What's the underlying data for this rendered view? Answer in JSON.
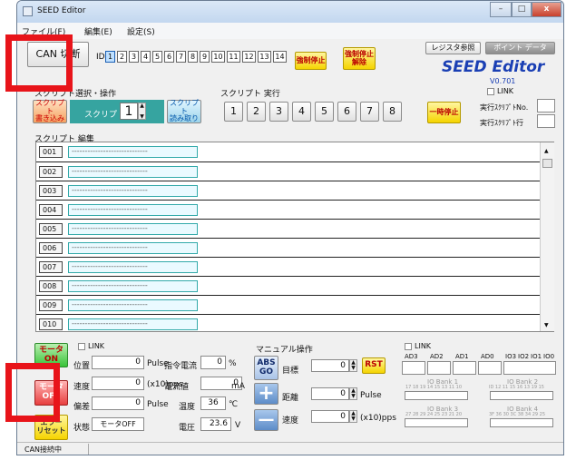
{
  "window": {
    "title": "SEED Editor",
    "minimize": "–",
    "maximize": "□",
    "close": "x"
  },
  "menu": {
    "file": "ファイル(F)",
    "edit": "編集(E)",
    "settings": "設定(S)"
  },
  "top": {
    "can_button": "CAN 切断",
    "id_label": "ID",
    "ids": [
      "1",
      "2",
      "3",
      "4",
      "5",
      "6",
      "7",
      "8",
      "9",
      "10",
      "11",
      "12",
      "13",
      "14"
    ],
    "force_stop": "強制停止",
    "force_release": "強制停止\n解除",
    "register_ref": "レジスタ参照",
    "point_data": "ポイント データ",
    "brand": "SEED Editor",
    "version": "V0.701",
    "link": "LINK",
    "exec_script_no": "実行ｽｸﾘﾌﾟﾄNo.",
    "exec_script_line": "実行ｽｸﾘﾌﾟﾄ行"
  },
  "script_select": {
    "label": "スクリプト選択・操作",
    "write": "スクリプト\n書き込み",
    "script_label": "スクリプト",
    "script_value": "1",
    "read": "スクリプト\n読み取り"
  },
  "script_exec": {
    "label": "スクリプト 実行",
    "buttons": [
      "1",
      "2",
      "3",
      "4",
      "5",
      "6",
      "7",
      "8"
    ],
    "pause": "一時停止"
  },
  "editor": {
    "label": "スクリプト 編集",
    "rows": [
      {
        "num": "001",
        "text": "-----------------------------"
      },
      {
        "num": "002",
        "text": "-----------------------------"
      },
      {
        "num": "003",
        "text": "-----------------------------"
      },
      {
        "num": "004",
        "text": "-----------------------------"
      },
      {
        "num": "005",
        "text": "-----------------------------"
      },
      {
        "num": "006",
        "text": "-----------------------------"
      },
      {
        "num": "007",
        "text": "-----------------------------"
      },
      {
        "num": "008",
        "text": "-----------------------------"
      },
      {
        "num": "009",
        "text": "-----------------------------"
      },
      {
        "num": "010",
        "text": "-----------------------------"
      }
    ]
  },
  "motor": {
    "on": "モータ\nON",
    "off": "モータ\nOFF",
    "reset": "エラー\nリセット",
    "link": "LINK",
    "position_label": "位置",
    "position": "0",
    "pulse_unit": "Pulse",
    "speed_label": "速度",
    "speed": "0",
    "speed_unit": "(x10)pps",
    "deviation_label": "偏差",
    "deviation": "0",
    "deviation_unit": "Pulse",
    "state_label": "状態",
    "state": "モータOFF",
    "cmd_current_label": "指令電流",
    "cmd_current": "0",
    "cmd_current_unit": "%",
    "current_label": "電流値",
    "current": "0",
    "current_unit": "mA",
    "temp_label": "温度",
    "temp": "36",
    "temp_unit": "℃",
    "voltage_label": "電圧",
    "voltage": "23.6",
    "voltage_unit": "V"
  },
  "manual": {
    "label": "マニュアル操作",
    "abs": "ABS\nGO",
    "target_label": "目標",
    "target": "0",
    "rst": "RST",
    "plus": "+",
    "distance_label": "距離",
    "distance": "0",
    "distance_unit": "Pulse",
    "minus": "—",
    "speed_label": "速度",
    "speed": "0",
    "speed_unit": "(x10)pps"
  },
  "io": {
    "link": "LINK",
    "ad_labels": [
      "AD3",
      "AD2",
      "AD1",
      "AD0",
      "IO3",
      "IO2",
      "IO1",
      "IO0"
    ],
    "bank1": "IO Bank 1",
    "bank2": "IO Bank 2",
    "bank3": "IO Bank 3",
    "bank4": "IO Bank 4",
    "bank1_bits": "17 18 19 14  15 13 11 10",
    "bank2_bits": "ID 12  11 15  16 13 19 15",
    "bank3_bits": "27 28 29 24  25 23 21 20",
    "bank4_bits": "3F 36 30 3C  38 34 29 25"
  },
  "status": {
    "text": "CAN接続中"
  }
}
